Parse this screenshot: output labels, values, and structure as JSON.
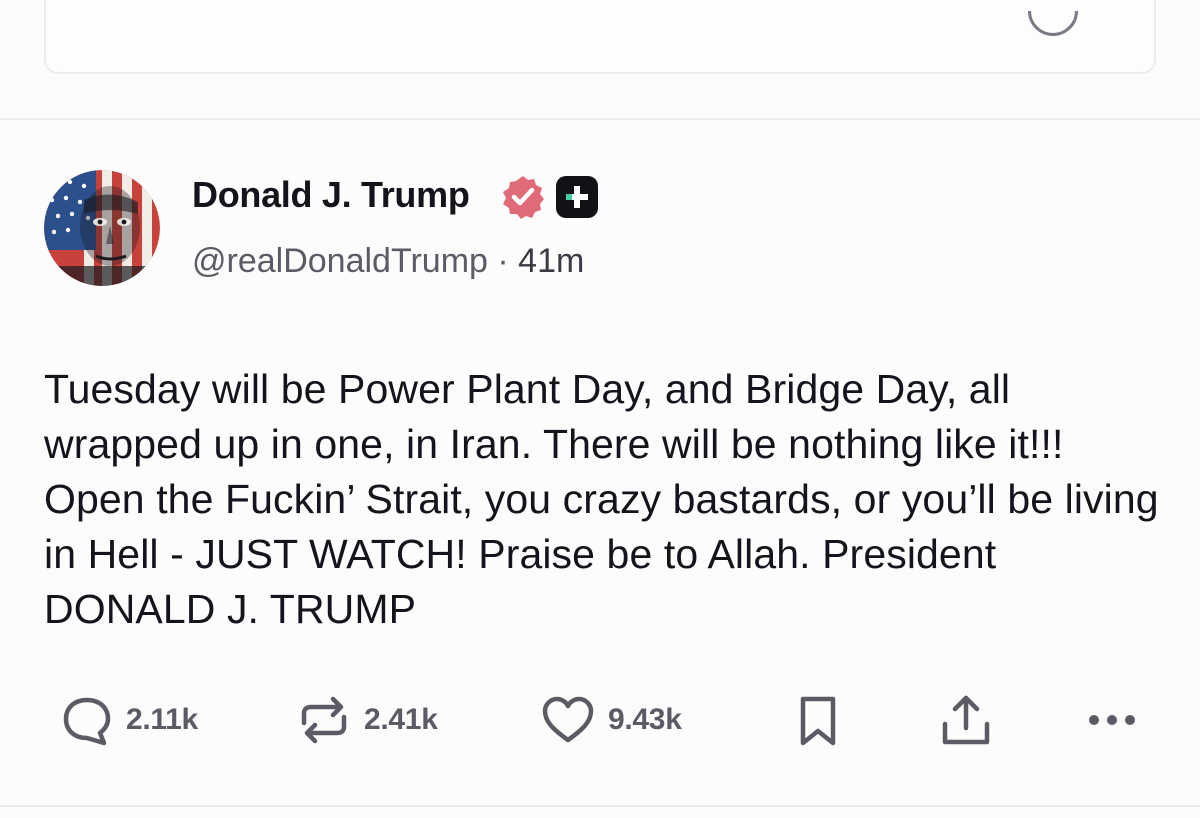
{
  "post": {
    "author_name": "Donald J. Trump",
    "handle": "@realDonaldTrump",
    "separator": "·",
    "time": "41m",
    "verified": true,
    "text": "Tuesday will be Power Plant Day, and Bridge Day, all wrapped up in one, in Iran. There will be nothing like it!!! Open the Fuckin’ Strait, you crazy bastards, or you’ll be living in Hell - JUST WATCH! Praise be to Allah. President DONALD J. TRUMP"
  },
  "actions": {
    "replies": "2.11k",
    "reposts": "2.41k",
    "likes": "9.43k"
  },
  "icons": {
    "reply": "speech-bubble-icon",
    "repost": "repost-arrows-icon",
    "like": "heart-icon",
    "bookmark": "bookmark-icon",
    "share": "share-upload-icon",
    "more": "ellipsis-icon",
    "verified": "verified-badge-icon",
    "plus": "plus-badge-icon"
  },
  "colors": {
    "verified_badge": "#e06a78",
    "icon_gray": "#5b5b66",
    "plus_badge_bg": "#111116"
  }
}
